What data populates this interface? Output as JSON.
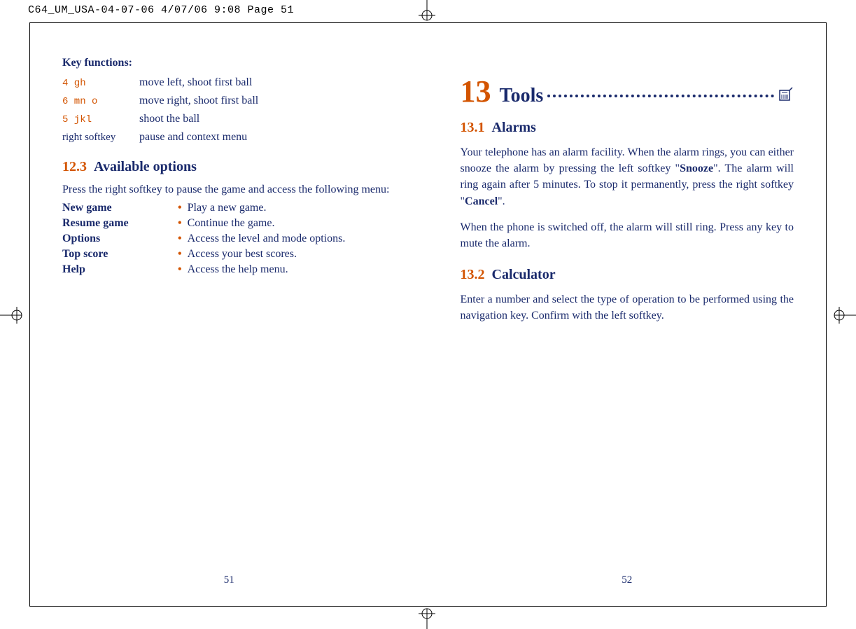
{
  "print_header": "C64_UM_USA-04-07-06  4/07/06  9:08  Page 51",
  "left": {
    "kf_heading": "Key functions:",
    "keys": [
      {
        "key_icon": "4 gh",
        "desc": "move left, shoot first ball"
      },
      {
        "key_icon": "6 mn o",
        "desc": "move right, shoot first ball"
      },
      {
        "key_icon": "5 jkl",
        "desc": "shoot the ball"
      },
      {
        "key_icon_plain": "right softkey",
        "desc": "pause and context menu"
      }
    ],
    "section_number": "12.3",
    "section_title": "Available options",
    "section_intro": "Press the right softkey to pause the game and access the following menu:",
    "options": [
      {
        "label": "New game",
        "desc": "Play a new game."
      },
      {
        "label": "Resume game",
        "desc": "Continue the game."
      },
      {
        "label": "Options",
        "desc": "Access the level and mode options."
      },
      {
        "label": "Top score",
        "desc": "Access your best scores."
      },
      {
        "label": "Help",
        "desc": "Access the help menu."
      }
    ],
    "page_number": "51"
  },
  "right": {
    "chapter_number": "13",
    "chapter_title": "Tools",
    "s1_number": "13.1",
    "s1_title": "Alarms",
    "s1_p1_a": "Your telephone has an alarm facility. When the alarm rings, you can either snooze the alarm by pressing the left softkey \"",
    "s1_p1_b": "Snooze",
    "s1_p1_c": "\". The alarm will ring again after 5 minutes. To stop it permanently, press the right softkey \"",
    "s1_p1_d": "Cancel",
    "s1_p1_e": "\".",
    "s1_p2": "When the phone is switched off, the alarm will still ring. Press any key to mute the alarm.",
    "s2_number": "13.2",
    "s2_title": "Calculator",
    "s2_p1": "Enter a number and select the type of operation to be performed using the navigation key. Confirm with the left softkey.",
    "page_number": "52"
  }
}
